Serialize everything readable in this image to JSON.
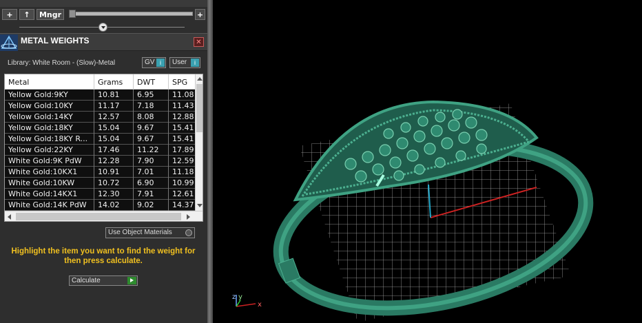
{
  "toolbar": {
    "add_label": "+",
    "up_label": "↑",
    "manager_label": "Mngr",
    "slider_plus_label": "+"
  },
  "panel": {
    "title": "METAL WEIGHTS",
    "close_label": "✕",
    "library_label": "Library: White Room - (Slow)-Metal",
    "gv_label": "GV",
    "user_label": "User",
    "toggle_indicator": "i"
  },
  "table": {
    "columns": [
      "Metal",
      "Grams",
      "DWT",
      "SPG"
    ],
    "rows": [
      [
        "Yellow Gold:9KY",
        "10.81",
        "6.95",
        "11.08"
      ],
      [
        "Yellow Gold:10KY",
        "11.17",
        "7.18",
        "11.43"
      ],
      [
        "Yellow Gold:14KY",
        "12.57",
        "8.08",
        "12.88"
      ],
      [
        "Yellow Gold:18KY",
        "15.04",
        "9.67",
        "15.41"
      ],
      [
        "Yellow Gold:18KY R...",
        "15.04",
        "9.67",
        "15.41"
      ],
      [
        "Yellow Gold:22KY",
        "17.46",
        "11.22",
        "17.89"
      ],
      [
        "White Gold:9K PdW",
        "12.28",
        "7.90",
        "12.59"
      ],
      [
        "White Gold:10KX1",
        "10.91",
        "7.01",
        "11.18"
      ],
      [
        "White Gold:10KW",
        "10.72",
        "6.90",
        "10.99"
      ],
      [
        "White Gold:14KX1",
        "12.30",
        "7.91",
        "12.61"
      ],
      [
        "White Gold:14K PdW",
        "14.02",
        "9.02",
        "14.37"
      ]
    ]
  },
  "use_object_materials_label": "Use Object Materials",
  "hint": "Highlight the item you want to find the weight for then press calculate.",
  "calculate_label": "Calculate",
  "axes": {
    "z": "z",
    "y": "y",
    "x": "x"
  },
  "colors": {
    "ring": "#2f8a70",
    "hint": "#f0c020",
    "axis_x": "#cc2222",
    "axis_y": "#22aacc"
  }
}
